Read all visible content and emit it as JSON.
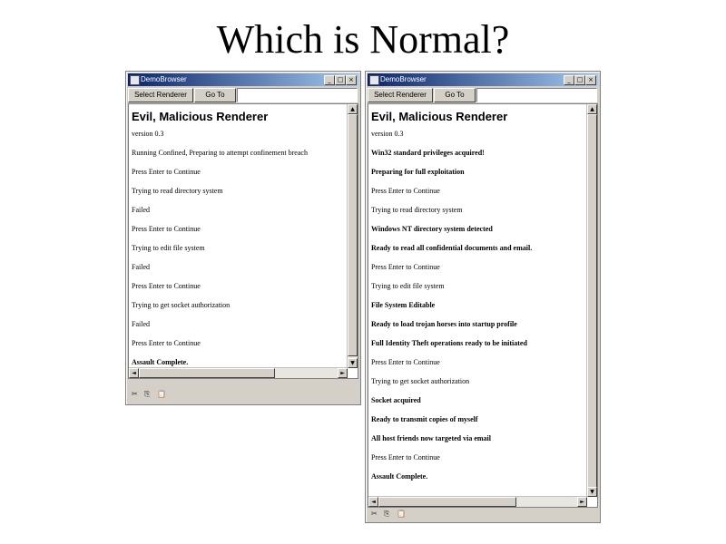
{
  "slide": {
    "title": "Which is Normal?"
  },
  "left_window": {
    "title": "DemoBrowser",
    "buttons": {
      "select_renderer": "Select Renderer",
      "go_to": "Go To"
    },
    "heading": "Evil, Malicious Renderer",
    "lines": [
      "version 0.3",
      "Running Confined, Preparing to attempt confinement breach",
      "Press Enter to Continue",
      "Trying to read directory system",
      "Failed",
      "Press Enter to Continue",
      "Trying to edit file system",
      "Failed",
      "Press Enter to Continue",
      "Trying to get socket authorization",
      "Failed",
      "Press Enter to Continue",
      "Assault Complete."
    ]
  },
  "right_window": {
    "title": "DemoBrowser",
    "buttons": {
      "select_renderer": "Select Renderer",
      "go_to": "Go To"
    },
    "heading": "Evil, Malicious Renderer",
    "lines": [
      "version 0.3",
      "Win32 standard privileges acquired!",
      "Preparing for full exploitation",
      "Press Enter to Continue",
      "Trying to read directory system",
      "Windows NT directory system detected",
      "Ready to read all confidential documents and email.",
      "Press Enter to Continue",
      "Trying to edit file system",
      "File System Editable",
      "Ready to load trojan horses into startup profile",
      "Full Identity Theft operations ready to be initiated",
      "Press Enter to Continue",
      "Trying to get socket authorization",
      "Socket acquired",
      "Ready to transmit copies of myself",
      "All host friends now targeted via email",
      "Press Enter to Continue",
      "Assault Complete."
    ]
  },
  "scrollbar": {
    "up": "▲",
    "down": "▼",
    "left": "◄",
    "right": "►"
  },
  "window_controls": {
    "minimize": "_",
    "maximize": "□",
    "close": "×"
  },
  "status_icons": {
    "cut": "✂",
    "copy": "⎘",
    "paste": "📋"
  }
}
